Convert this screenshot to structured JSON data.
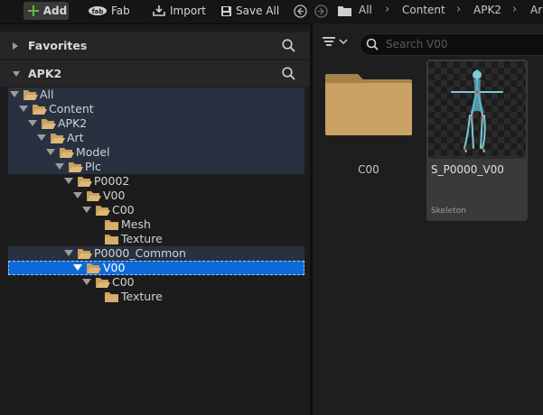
{
  "toolbar": {
    "add_label": "Add",
    "fab_label": "Fab",
    "import_label": "Import",
    "save_all_label": "Save All"
  },
  "breadcrumb": [
    "All",
    "Content",
    "APK2",
    "Ar"
  ],
  "panels": {
    "favorites_label": "Favorites",
    "project_label": "APK2"
  },
  "tree": [
    {
      "label": "All"
    },
    {
      "label": "Content"
    },
    {
      "label": "APK2"
    },
    {
      "label": "Art"
    },
    {
      "label": "Model"
    },
    {
      "label": "Plc"
    },
    {
      "label": "P0002"
    },
    {
      "label": "V00"
    },
    {
      "label": "C00"
    },
    {
      "label": "Mesh"
    },
    {
      "label": "Texture"
    },
    {
      "label": "P0000_Common"
    },
    {
      "label": "V00"
    },
    {
      "label": "C00"
    },
    {
      "label": "Texture"
    }
  ],
  "search": {
    "placeholder": "Search V00"
  },
  "assets": [
    {
      "name": "C00",
      "kind": "folder"
    },
    {
      "name": "S_P0000_V00",
      "type": "Skeleton"
    }
  ],
  "colors": {
    "selection": "#0e6ad8",
    "highlight": "#283140",
    "folder": "#c8a15f",
    "skeleton": "#7ec8d8"
  }
}
